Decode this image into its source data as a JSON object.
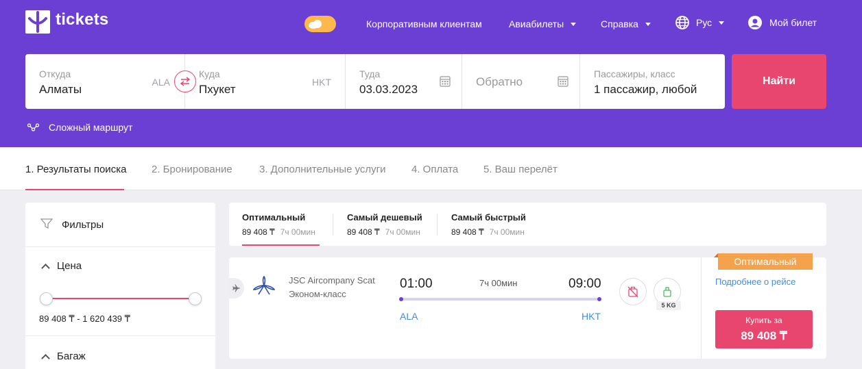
{
  "header": {
    "logo_text": "tickets",
    "nav": {
      "corporate": "Корпоративным клиентам",
      "flights": "Авиабилеты",
      "help": "Справка",
      "language": "Рус",
      "my_ticket": "Мой билет"
    },
    "accent": "#6b3fd3"
  },
  "search": {
    "from_label": "Откуда",
    "from_value": "Алматы",
    "from_code": "ALA",
    "to_label": "Куда",
    "to_value": "Пхукет",
    "to_code": "HKT",
    "depart_label": "Туда",
    "depart_value": "03.03.2023",
    "return_placeholder": "Обратно",
    "passengers_label": "Пассажиры, класс",
    "passengers_value": "1 пассажир, любой",
    "find_button": "Найти",
    "complex_route": "Сложный маршрут"
  },
  "steps": [
    {
      "label": "1. Результаты поиска",
      "active": true
    },
    {
      "label": "2. Бронирование"
    },
    {
      "label": "3. Дополнительные услуги"
    },
    {
      "label": "4. Оплата"
    },
    {
      "label": "5. Ваш перелёт"
    }
  ],
  "filters": {
    "title": "Фильтры",
    "price_title": "Цена",
    "price_range": "89 408 ₸  -  1 620 439 ₸",
    "baggage_title": "Багаж"
  },
  "sort_tabs": [
    {
      "title": "Оптимальный",
      "price": "89 408 ₸",
      "duration": "7ч 00мин"
    },
    {
      "title": "Самый дешевый",
      "price": "89 408 ₸",
      "duration": "7ч 00мин"
    },
    {
      "title": "Самый быстрый",
      "price": "89 408 ₸",
      "duration": "7ч 00мин"
    }
  ],
  "result": {
    "airline": "JSC Aircompany Scat",
    "cabin": "Эконом-класс",
    "dep_time": "01:00",
    "arr_time": "09:00",
    "duration": "7ч 00мин",
    "dep_code": "ALA",
    "arr_code": "HKT",
    "baggage_weight": "5 KG",
    "badge": "Оптимальный",
    "details_link": "Подробнее о рейсе",
    "buy_label": "Купить за",
    "buy_price": "89 408 ₸"
  }
}
